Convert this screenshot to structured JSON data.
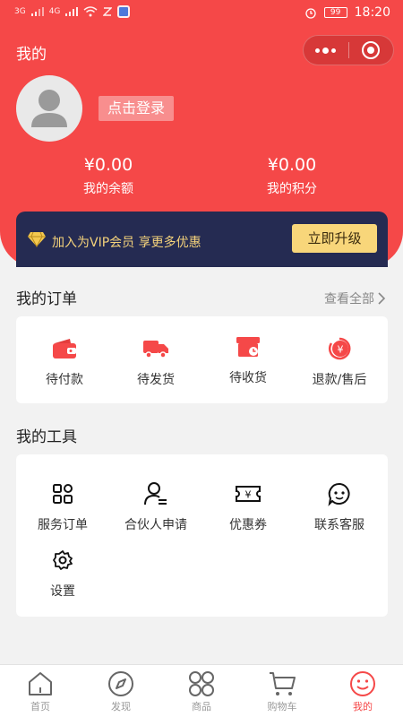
{
  "status_bar": {
    "network_left": "3G",
    "network_right": "4G",
    "battery": "99",
    "time": "18:20"
  },
  "header": {
    "title": "我的",
    "login_label": "点击登录",
    "balance_value": "¥0.00",
    "balance_label": "我的余额",
    "points_value": "¥0.00",
    "points_label": "我的积分"
  },
  "vip_banner": {
    "text": "加入为VIP会员 享更多优惠",
    "button": "立即升级"
  },
  "orders": {
    "title": "我的订单",
    "see_all": "查看全部",
    "items": [
      {
        "label": "待付款",
        "icon": "wallet-icon"
      },
      {
        "label": "待发货",
        "icon": "truck-icon"
      },
      {
        "label": "待收货",
        "icon": "box-icon"
      },
      {
        "label": "退款/售后",
        "icon": "refund-icon"
      }
    ]
  },
  "tools": {
    "title": "我的工具",
    "items": [
      {
        "label": "服务订单",
        "icon": "grid-icon"
      },
      {
        "label": "合伙人申请",
        "icon": "user-list-icon"
      },
      {
        "label": "优惠券",
        "icon": "coupon-icon"
      },
      {
        "label": "联系客服",
        "icon": "chat-icon"
      },
      {
        "label": "设置",
        "icon": "gear-icon"
      }
    ]
  },
  "tabbar": {
    "items": [
      {
        "label": "首页",
        "icon": "home-icon"
      },
      {
        "label": "发现",
        "icon": "compass-icon"
      },
      {
        "label": "商品",
        "icon": "apps-icon"
      },
      {
        "label": "购物车",
        "icon": "cart-icon"
      },
      {
        "label": "我的",
        "icon": "smile-icon"
      }
    ],
    "active_index": 4
  },
  "colors": {
    "primary": "#f54848",
    "vip_bg": "#252b52",
    "vip_gold": "#f8d67a"
  }
}
